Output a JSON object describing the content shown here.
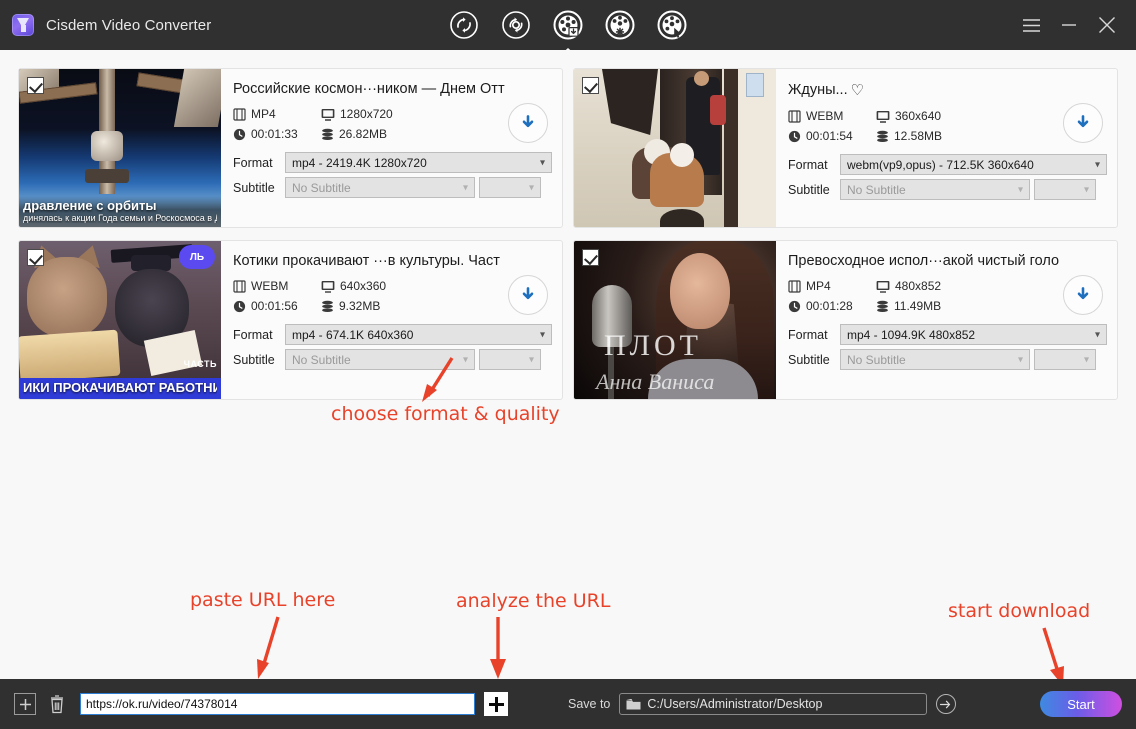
{
  "window": {
    "title": "Cisdem Video Converter",
    "menu_icon": "hamburger-icon",
    "minimize_icon": "minimize-icon",
    "close_icon": "close-icon"
  },
  "toolbar": {
    "items": [
      {
        "name": "convert-icon",
        "label": "Convert",
        "active": false
      },
      {
        "name": "compress-icon",
        "label": "Compress",
        "active": false
      },
      {
        "name": "download-icon",
        "label": "Download",
        "active": true
      },
      {
        "name": "edit-icon",
        "label": "Edit",
        "active": false
      },
      {
        "name": "dvd-icon",
        "label": "DVD",
        "active": false
      }
    ]
  },
  "labels": {
    "format": "Format",
    "subtitle": "Subtitle",
    "no_subtitle": "No Subtitle",
    "save_to": "Save to"
  },
  "videos": [
    {
      "title": "Российские космон···ником — Днем Отт",
      "favorite": false,
      "checked": true,
      "container": "MP4",
      "resolution": "1280x720",
      "duration": "00:01:33",
      "size": "26.82MB",
      "format": "mp4 - 2419.4K 1280x720",
      "subtitle": "No Subtitle",
      "thumb_overlay_title": "дравление с орбиты",
      "thumb_overlay_sub": "динялась к акции Года семьи и Роскосмоса в Ден"
    },
    {
      "title": "Ждуны...",
      "favorite": true,
      "checked": true,
      "container": "WEBM",
      "resolution": "360x640",
      "duration": "00:01:54",
      "size": "12.58MB",
      "format": "webm(vp9,opus) - 712.5K 360x640",
      "subtitle": "No Subtitle",
      "thumb_overlay_title": "",
      "thumb_overlay_sub": ""
    },
    {
      "title": "Котики прокачивают ···в культуры. Част",
      "favorite": false,
      "checked": true,
      "container": "WEBM",
      "resolution": "640x360",
      "duration": "00:01:56",
      "size": "9.32MB",
      "format": "mp4 - 674.1K 640x360",
      "subtitle": "No Subtitle",
      "thumb_overlay_title": "ИКИ ПРОКАЧИВАЮТ РАБОТНИКОВ КУЛЬТУР",
      "thumb_overlay_sub": "",
      "thumb_badge": "ЛЬ",
      "thumb_corner": "ЧАСТЬ"
    },
    {
      "title": "Превосходное испол···акой чистый голо",
      "favorite": false,
      "checked": true,
      "container": "MP4",
      "resolution": "480x852",
      "duration": "00:01:28",
      "size": "11.49MB",
      "format": "mp4 - 1094.9K 480x852",
      "subtitle": "No Subtitle",
      "thumb_overlay_title": "ПЛОТ",
      "thumb_overlay_sub": "Анна Ваниса"
    }
  ],
  "annotations": [
    {
      "text": "choose format & quality",
      "name": "annotation-choose-format"
    },
    {
      "text": "paste URL here",
      "name": "annotation-paste-url"
    },
    {
      "text": "analyze the URL",
      "name": "annotation-analyze-url"
    },
    {
      "text": "start download",
      "name": "annotation-start-download"
    }
  ],
  "bottom": {
    "add_icon": "plus-box-icon",
    "delete_icon": "trash-icon",
    "url_value": "https://ok.ru/video/74378014",
    "url_placeholder": "Paste URL here",
    "analyze_icon": "plus-icon",
    "save_path": "C:/Users/Administrator/Desktop",
    "folder_icon": "folder-icon",
    "open_folder_icon": "arrow-right-icon",
    "start_label": "Start"
  },
  "colors": {
    "accent_red": "#e8432a",
    "titlebar": "#303030",
    "download_blue": "#1f6fbf",
    "start_gradient_from": "#3f8ae0",
    "start_gradient_to": "#cf4fe0"
  }
}
